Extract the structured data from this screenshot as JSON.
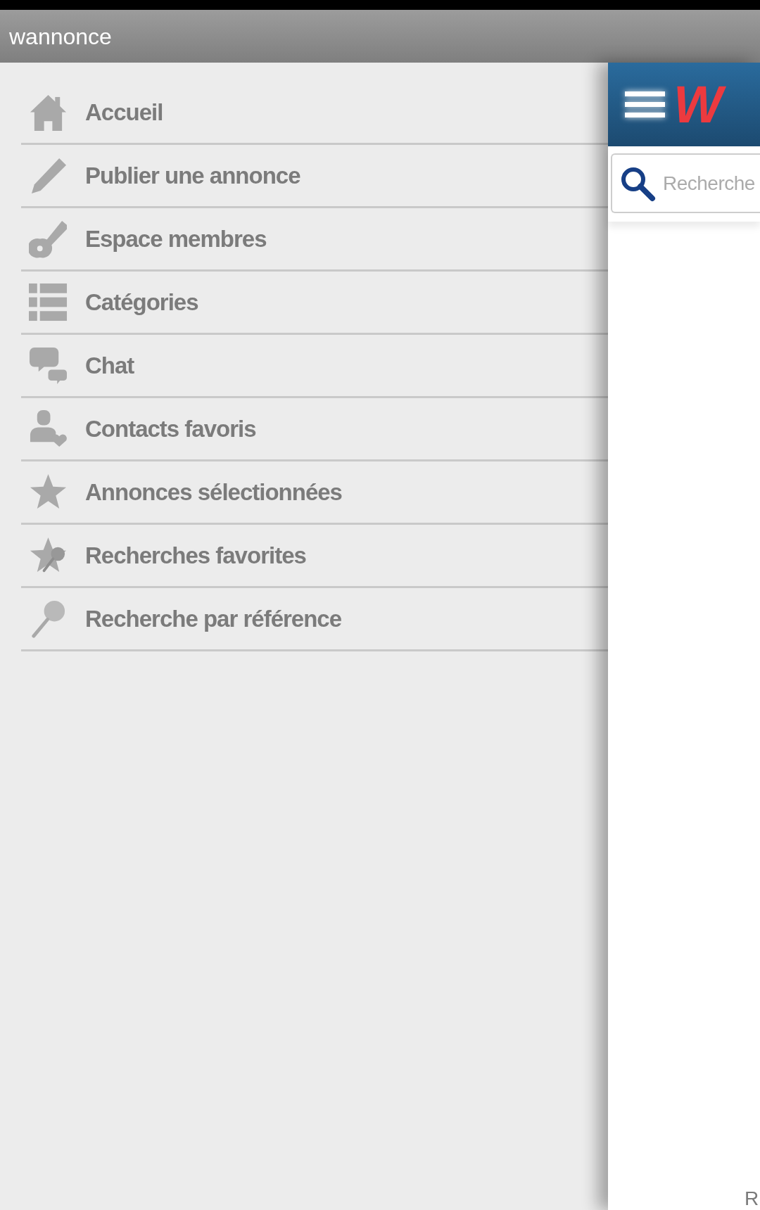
{
  "app_bar": {
    "title": "wannonce"
  },
  "menu": [
    {
      "kind": "home",
      "label": "Accueil"
    },
    {
      "kind": "pencil",
      "label": "Publier une annonce"
    },
    {
      "kind": "key",
      "label": "Espace membres"
    },
    {
      "kind": "list",
      "label": "Catégories"
    },
    {
      "kind": "chat",
      "label": "Chat"
    },
    {
      "kind": "contact",
      "label": "Contacts favoris"
    },
    {
      "kind": "star",
      "label": "Annonces sélectionnées"
    },
    {
      "kind": "saved",
      "label": "Recherches favorites"
    },
    {
      "kind": "lookup",
      "label": "Recherche par référence"
    }
  ],
  "content": {
    "header": {
      "logo": "W"
    },
    "search": {
      "placeholder": "Recherche"
    },
    "cut_text": "R"
  }
}
